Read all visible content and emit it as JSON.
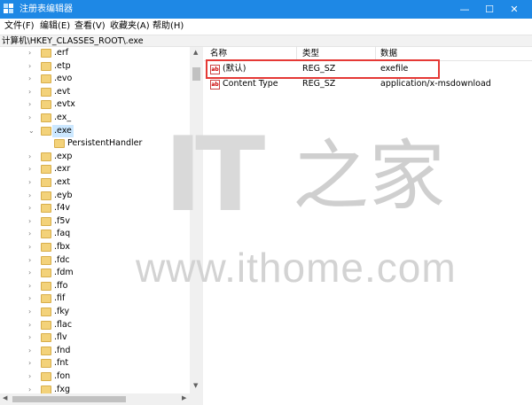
{
  "window": {
    "title": "注册表编辑器",
    "minimize_glyph": "—",
    "maximize_glyph": "☐",
    "close_glyph": "✕"
  },
  "menu": [
    {
      "label": "文件(F)"
    },
    {
      "label": "编辑(E)"
    },
    {
      "label": "查看(V)"
    },
    {
      "label": "收藏夹(A)"
    },
    {
      "label": "帮助(H)"
    }
  ],
  "address": {
    "path": "计算机\\HKEY_CLASSES_ROOT\\.exe"
  },
  "tree": {
    "items": [
      {
        "label": ".erf",
        "expanded": false
      },
      {
        "label": ".etp",
        "expanded": false
      },
      {
        "label": ".evo",
        "expanded": false
      },
      {
        "label": ".evt",
        "expanded": false
      },
      {
        "label": ".evtx",
        "expanded": false
      },
      {
        "label": ".ex_",
        "expanded": false
      },
      {
        "label": ".exe",
        "expanded": true,
        "selected": true
      },
      {
        "label": "PersistentHandler",
        "child": true
      },
      {
        "label": ".exp",
        "expanded": false
      },
      {
        "label": ".exr",
        "expanded": false
      },
      {
        "label": ".ext",
        "expanded": false
      },
      {
        "label": ".eyb",
        "expanded": false
      },
      {
        "label": ".f4v",
        "expanded": false
      },
      {
        "label": ".f5v",
        "expanded": false
      },
      {
        "label": ".faq",
        "expanded": false
      },
      {
        "label": ".fbx",
        "expanded": false
      },
      {
        "label": ".fdc",
        "expanded": false
      },
      {
        "label": ".fdm",
        "expanded": false
      },
      {
        "label": ".ffo",
        "expanded": false
      },
      {
        "label": ".fif",
        "expanded": false
      },
      {
        "label": ".fky",
        "expanded": false
      },
      {
        "label": ".flac",
        "expanded": false
      },
      {
        "label": ".flv",
        "expanded": false
      },
      {
        "label": ".fnd",
        "expanded": false
      },
      {
        "label": ".fnt",
        "expanded": false
      },
      {
        "label": ".fon",
        "expanded": false
      },
      {
        "label": ".fxg",
        "expanded": false
      }
    ]
  },
  "list": {
    "columns": [
      "名称",
      "类型",
      "数据"
    ],
    "rows": [
      {
        "icon": "ab",
        "name": "(默认)",
        "type": "REG_SZ",
        "data": "exefile",
        "highlighted": true
      },
      {
        "icon": "ab",
        "name": "Content Type",
        "type": "REG_SZ",
        "data": "application/x-msdownload"
      }
    ]
  },
  "watermark": {
    "logo_text": "IT",
    "logo_cjk": "之家",
    "url": "www.ithome.com"
  },
  "colors": {
    "titlebar": "#1e88e5",
    "selection": "#cce8ff",
    "highlight_box": "#e53935",
    "folder": "#f3d27a"
  }
}
